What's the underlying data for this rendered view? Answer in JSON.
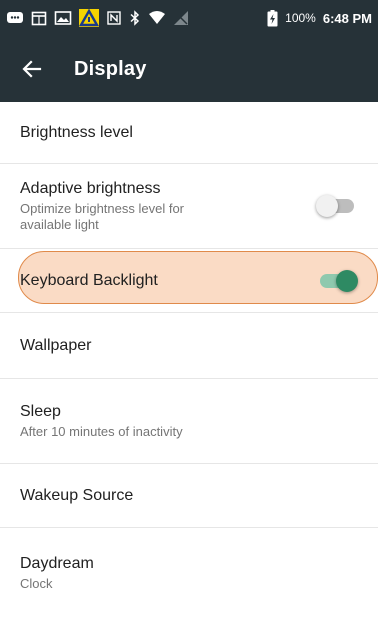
{
  "status_bar": {
    "battery_percent": "100%",
    "time": "6:48 PM",
    "icons": [
      "message-icon",
      "calendar-icon",
      "image-icon",
      "warning-icon",
      "nfc-icon",
      "bluetooth-icon",
      "wifi-icon",
      "no-signal-icon",
      "battery-icon"
    ],
    "background": "#263238"
  },
  "app_bar": {
    "title": "Display",
    "background": "#263238"
  },
  "settings": [
    {
      "title": "Brightness level"
    },
    {
      "title": "Adaptive brightness",
      "subtitle_line1": "Optimize brightness level for",
      "subtitle_line2": "available light",
      "toggle": "off"
    },
    {
      "title": "Keyboard Backlight",
      "toggle": "on"
    },
    {
      "title": "Wallpaper"
    },
    {
      "title": "Sleep",
      "subtitle": "After 10 minutes of inactivity"
    },
    {
      "title": "Wakeup Source"
    },
    {
      "title": "Daydream",
      "subtitle": "Clock"
    }
  ],
  "colors": {
    "toggle_on_thumb": "#2e8a63",
    "toggle_on_track": "#8fc9ae",
    "highlight_fill": "#f6be96",
    "highlight_border": "#e08a4a"
  }
}
